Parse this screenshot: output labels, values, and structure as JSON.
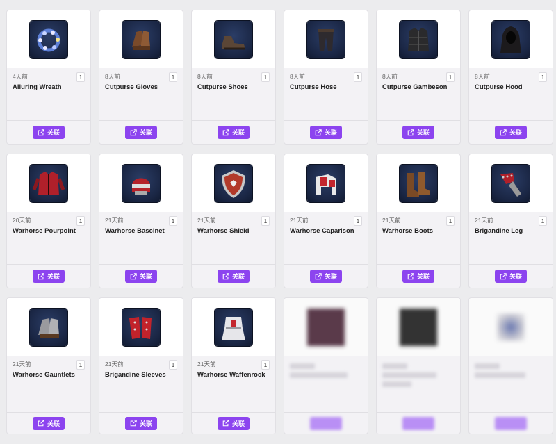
{
  "cards": [
    {
      "age": "4天前",
      "count": "1",
      "name": "Alluring Wreath",
      "button": "关联"
    },
    {
      "age": "8天前",
      "count": "1",
      "name": "Cutpurse Gloves",
      "button": "关联"
    },
    {
      "age": "8天前",
      "count": "1",
      "name": "Cutpurse Shoes",
      "button": "关联"
    },
    {
      "age": "8天前",
      "count": "1",
      "name": "Cutpurse Hose",
      "button": "关联"
    },
    {
      "age": "8天前",
      "count": "1",
      "name": "Cutpurse Gambeson",
      "button": "关联"
    },
    {
      "age": "8天前",
      "count": "1",
      "name": "Cutpurse Hood",
      "button": "关联"
    },
    {
      "age": "20天前",
      "count": "1",
      "name": "Warhorse Pourpoint",
      "button": "关联"
    },
    {
      "age": "21天前",
      "count": "1",
      "name": "Warhorse Bascinet",
      "button": "关联"
    },
    {
      "age": "21天前",
      "count": "1",
      "name": "Warhorse Shield",
      "button": "关联"
    },
    {
      "age": "21天前",
      "count": "1",
      "name": "Warhorse Caparison",
      "button": "关联"
    },
    {
      "age": "21天前",
      "count": "1",
      "name": "Warhorse Boots",
      "button": "关联"
    },
    {
      "age": "21天前",
      "count": "1",
      "name": "Brigandine Leg",
      "button": "关联"
    },
    {
      "age": "21天前",
      "count": "1",
      "name": "Warhorse Gauntlets",
      "button": "关联"
    },
    {
      "age": "21天前",
      "count": "1",
      "name": "Brigandine Sleeves",
      "button": "关联"
    },
    {
      "age": "21天前",
      "count": "1",
      "name": "Warhorse Waffenrock",
      "button": "关联"
    }
  ],
  "icons": [
    "flower-wreath-icon",
    "leather-gloves-icon",
    "leather-shoes-icon",
    "leather-hose-icon",
    "gambeson-icon",
    "hood-icon",
    "red-pourpoint-icon",
    "red-bascinet-helmet-icon",
    "heraldic-shield-icon",
    "horse-caparison-icon",
    "leather-boots-icon",
    "brigandine-leg-icon",
    "steel-gauntlets-icon",
    "red-brigandine-sleeves-icon",
    "white-waffenrock-icon"
  ],
  "colors": {
    "accent": "#8c44ef",
    "card_bg": "#f3f2f5",
    "page_bg": "#ececee"
  }
}
